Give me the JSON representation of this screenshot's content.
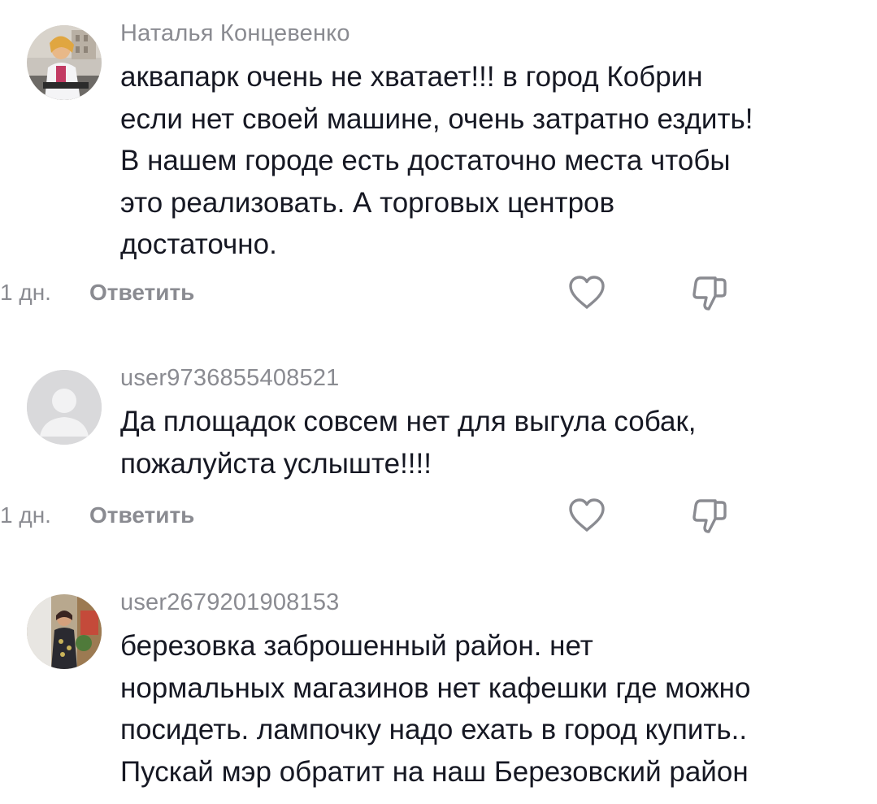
{
  "comments": [
    {
      "username": "Наталья Концевенко",
      "lines": [
        "аквапарк очень не хватает!!! в город Кобрин",
        "если нет своей машине, очень затратно ездить!",
        "В нашем городе есть достаточно места чтобы",
        "это реализовать. А торговых центров",
        "достаточно."
      ],
      "time": "1 дн.",
      "reply_label": "Ответить",
      "avatar": "photo-avatar"
    },
    {
      "username": "user9736855408521",
      "lines": [
        "Да площадок совсем нет для выгула собак,",
        "пожалуйста услыште!!!!"
      ],
      "time": "1 дн.",
      "reply_label": "Ответить",
      "avatar": "default-avatar"
    },
    {
      "username": "user2679201908153",
      "lines": [
        "березовка заброшенный район. нет",
        "нормальных магазинов нет кафешки где можно",
        "посидеть. лампочку надо ехать в город купить..",
        "Пускай мэр обратит на наш Березовский район"
      ],
      "time": "",
      "reply_label": "",
      "avatar": "photo-avatar"
    }
  ],
  "icons": {
    "like": "heart-outline-icon",
    "dislike": "thumbs-down-outline-icon"
  },
  "colors": {
    "text": "#161823",
    "secondary": "#8a8b91",
    "icon": "#8a8b91",
    "default_avatar_bg": "#d9d9db"
  }
}
